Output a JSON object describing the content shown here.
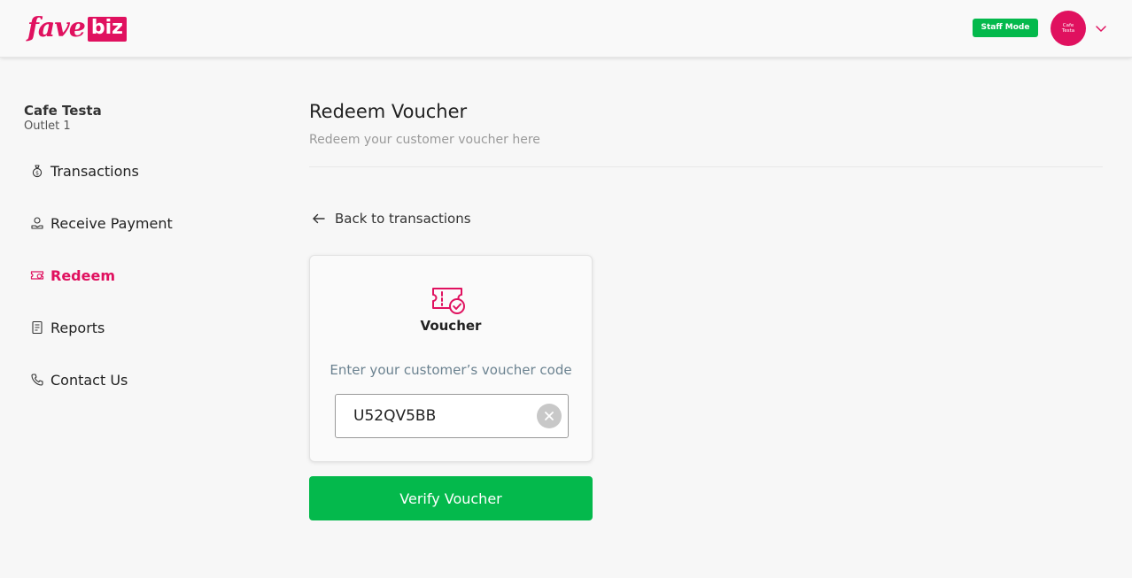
{
  "header": {
    "logo_main": "fave",
    "logo_badge": "biz",
    "staff_mode_label": "Staff Mode",
    "avatar_text": "Cafe Testa"
  },
  "sidebar": {
    "outlet_name": "Cafe Testa",
    "outlet_sub": "Outlet 1",
    "items": [
      {
        "label": "Transactions",
        "icon": "money-bag-icon",
        "active": false
      },
      {
        "label": "Receive Payment",
        "icon": "receive-payment-icon",
        "active": false
      },
      {
        "label": "Redeem",
        "icon": "ticket-icon",
        "active": true
      },
      {
        "label": "Reports",
        "icon": "report-icon",
        "active": false
      },
      {
        "label": "Contact Us",
        "icon": "phone-icon",
        "active": false
      }
    ]
  },
  "main": {
    "title": "Redeem Voucher",
    "subtitle": "Redeem your customer voucher here",
    "back_label": "Back to transactions",
    "card": {
      "icon": "voucher-check-icon",
      "title": "Voucher",
      "prompt": "Enter your customer’s voucher code",
      "code_value": "U52QV5BB"
    },
    "verify_label": "Verify Voucher"
  },
  "colors": {
    "brand": "#e0115f",
    "success": "#04b94c"
  }
}
